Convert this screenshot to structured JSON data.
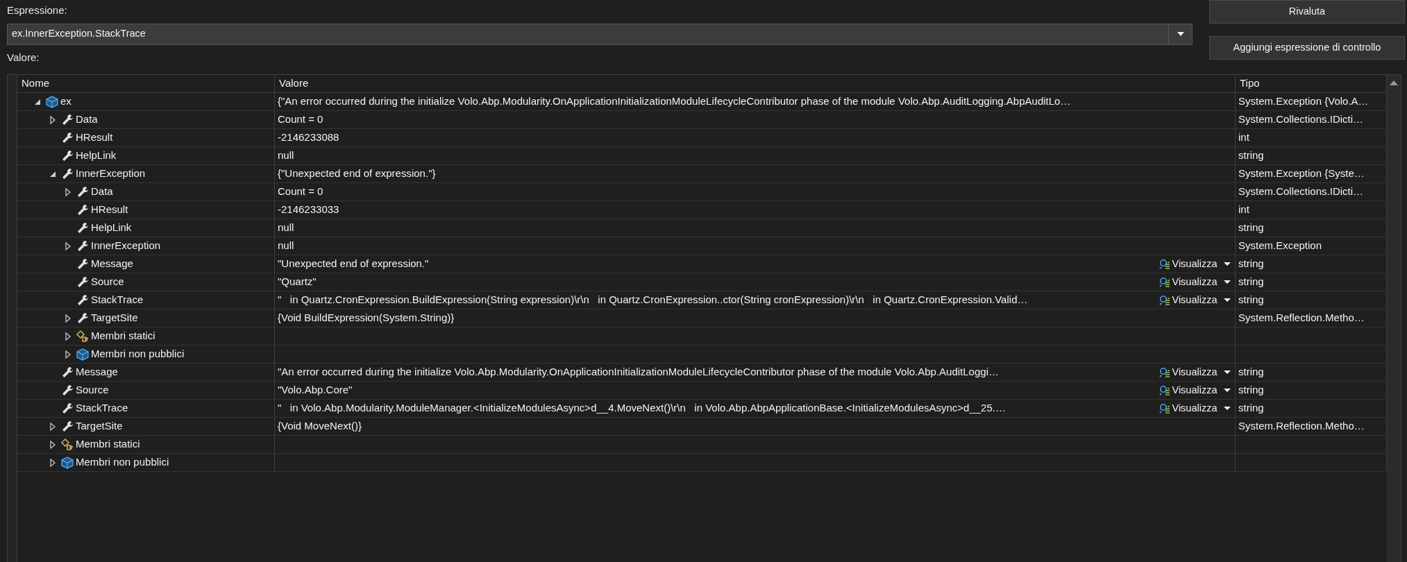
{
  "labels": {
    "expression": "Espressione:",
    "value": "Valore:"
  },
  "expression": {
    "value": "ex.InnerException.StackTrace"
  },
  "buttons": [
    "Rivaluta",
    "Aggiungi espressione di controllo"
  ],
  "grid": {
    "columns": [
      "Nome",
      "Valore",
      "Tipo"
    ],
    "rows": [
      {
        "name": "ex",
        "kind": "object",
        "expanded": true,
        "value": "{\"An error occurred during the initialize Volo.Abp.Modularity.OnApplicationInitializationModuleLifecycleContributor phase of the module Volo.Abp.AuditLogging.AbpAuditLo…",
        "type": "System.Exception {Volo.A…",
        "children": [
          {
            "name": "Data",
            "kind": "property",
            "expanded": false,
            "value": "Count = 0",
            "type": "System.Collections.IDicti…"
          },
          {
            "name": "HResult",
            "kind": "property",
            "value": "-2146233088",
            "type": "int"
          },
          {
            "name": "HelpLink",
            "kind": "property",
            "value": "null",
            "type": "string"
          },
          {
            "name": "InnerException",
            "kind": "property",
            "expanded": true,
            "value": "{\"Unexpected end of expression.\"}",
            "type": "System.Exception {Syste…",
            "children": [
              {
                "name": "Data",
                "kind": "property",
                "expanded": false,
                "value": "Count = 0",
                "type": "System.Collections.IDicti…"
              },
              {
                "name": "HResult",
                "kind": "property",
                "value": "-2146233033",
                "type": "int"
              },
              {
                "name": "HelpLink",
                "kind": "property",
                "value": "null",
                "type": "string"
              },
              {
                "name": "InnerException",
                "kind": "property",
                "expanded": false,
                "value": "null",
                "type": "System.Exception"
              },
              {
                "name": "Message",
                "kind": "property",
                "value": "\"Unexpected end of expression.\"",
                "visualizer": "Visualizza",
                "type": "string"
              },
              {
                "name": "Source",
                "kind": "property",
                "value": "\"Quartz\"",
                "visualizer": "Visualizza",
                "type": "string"
              },
              {
                "name": "StackTrace",
                "kind": "property",
                "value": "\"   in Quartz.CronExpression.BuildExpression(String expression)\\r\\n   in Quartz.CronExpression..ctor(String cronExpression)\\r\\n   in Quartz.CronExpression.Valid…",
                "visualizer": "Visualizza",
                "type": "string"
              },
              {
                "name": "TargetSite",
                "kind": "property",
                "expanded": false,
                "value": "{Void BuildExpression(System.String)}",
                "type": "System.Reflection.Metho…"
              },
              {
                "name": "Membri statici",
                "kind": "static",
                "expanded": false
              },
              {
                "name": "Membri non pubblici",
                "kind": "nonpublic",
                "expanded": false
              }
            ]
          },
          {
            "name": "Message",
            "kind": "property",
            "value": "\"An error occurred during the initialize Volo.Abp.Modularity.OnApplicationInitializationModuleLifecycleContributor phase of the module Volo.Abp.AuditLoggi…",
            "visualizer": "Visualizza",
            "type": "string"
          },
          {
            "name": "Source",
            "kind": "property",
            "value": "\"Volo.Abp.Core\"",
            "visualizer": "Visualizza",
            "type": "string"
          },
          {
            "name": "StackTrace",
            "kind": "property",
            "value": "\"   in Volo.Abp.Modularity.ModuleManager.<InitializeModulesAsync>d__4.MoveNext()\\r\\n   in Volo.Abp.AbpApplicationBase.<InitializeModulesAsync>d__25.…",
            "visualizer": "Visualizza",
            "type": "string"
          },
          {
            "name": "TargetSite",
            "kind": "property",
            "expanded": false,
            "value": "{Void MoveNext()}",
            "type": "System.Reflection.Metho…"
          },
          {
            "name": "Membri statici",
            "kind": "static",
            "expanded": false
          },
          {
            "name": "Membri non pubblici",
            "kind": "nonpublic",
            "expanded": false
          }
        ]
      }
    ]
  }
}
